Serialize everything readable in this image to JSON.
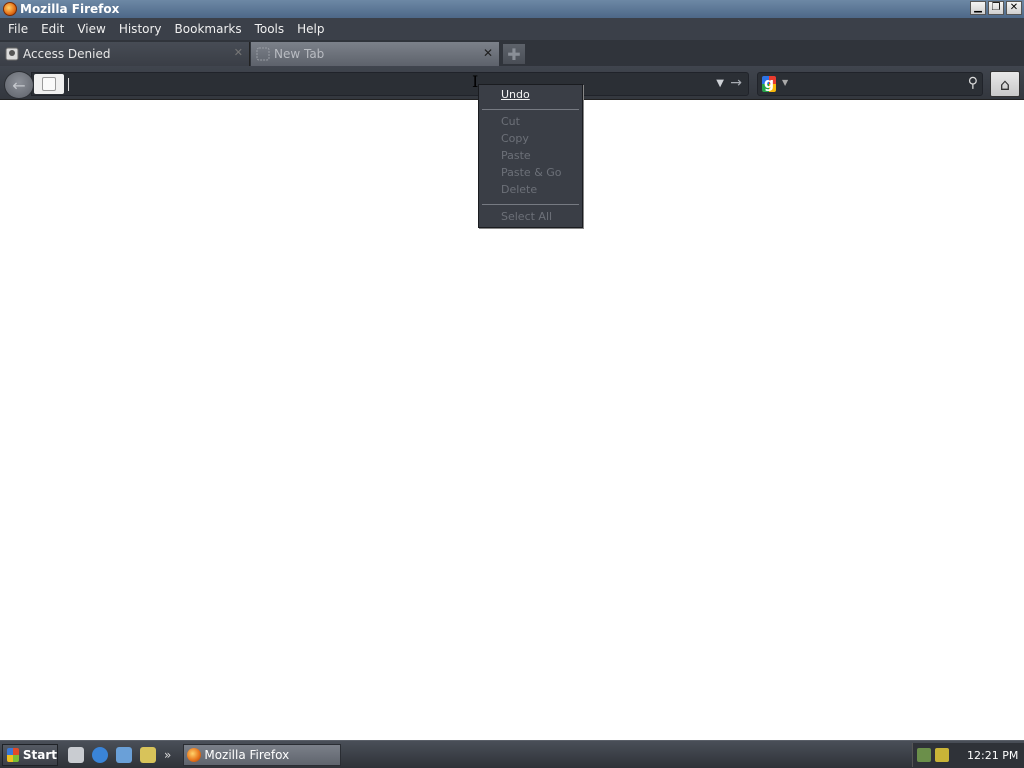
{
  "window": {
    "title": "Mozilla Firefox",
    "controls": [
      "minimize",
      "restore",
      "close"
    ]
  },
  "menubar": {
    "items": [
      "File",
      "Edit",
      "View",
      "History",
      "Bookmarks",
      "Tools",
      "Help"
    ]
  },
  "tabs": [
    {
      "label": "Access Denied",
      "active": false,
      "icon": "page-icon"
    },
    {
      "label": "New Tab",
      "active": true,
      "icon": "blank-page-icon"
    }
  ],
  "navbar": {
    "url_value": "",
    "search_engine": "google-icon",
    "search_value": ""
  },
  "context_menu": {
    "items": [
      {
        "label": "Undo",
        "enabled": true
      },
      {
        "label": "Cut",
        "enabled": false
      },
      {
        "label": "Copy",
        "enabled": false
      },
      {
        "label": "Paste",
        "enabled": false
      },
      {
        "label": "Paste & Go",
        "enabled": false
      },
      {
        "label": "Delete",
        "enabled": false
      },
      {
        "label": "Select All",
        "enabled": false
      }
    ]
  },
  "taskbar": {
    "start_label": "Start",
    "window_label": "Mozilla Firefox",
    "clock": "12:21 PM"
  },
  "colors": {
    "titlebar": "#5b7594",
    "chrome_dark": "#3b4049",
    "context_bg": "#3a3e46",
    "disabled_text": "#6c7078"
  }
}
